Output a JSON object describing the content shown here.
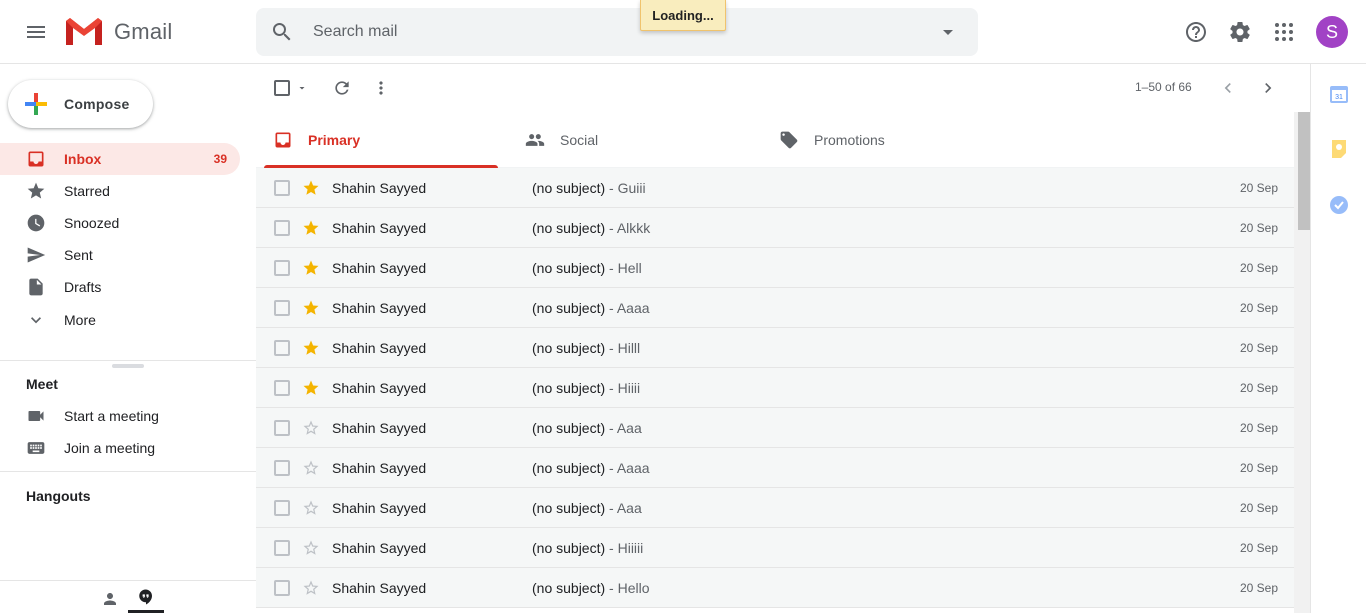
{
  "header": {
    "app_name": "Gmail",
    "search_placeholder": "Search mail",
    "loading_text": "Loading...",
    "avatar_letter": "S",
    "avatar_color": "#a142c5"
  },
  "sidebar": {
    "compose_label": "Compose",
    "nav": [
      {
        "label": "Inbox",
        "count": "39",
        "icon": "inbox-icon",
        "active": true
      },
      {
        "label": "Starred",
        "count": "",
        "icon": "star-icon"
      },
      {
        "label": "Snoozed",
        "count": "",
        "icon": "clock-icon"
      },
      {
        "label": "Sent",
        "count": "",
        "icon": "send-icon"
      },
      {
        "label": "Drafts",
        "count": "",
        "icon": "draft-icon"
      },
      {
        "label": "More",
        "count": "",
        "icon": "chevron-down-icon"
      }
    ],
    "meet_title": "Meet",
    "meet_items": [
      {
        "label": "Start a meeting",
        "icon": "video-camera-icon"
      },
      {
        "label": "Join a meeting",
        "icon": "keyboard-icon"
      }
    ],
    "hangouts_title": "Hangouts"
  },
  "toolbar": {
    "pagination": "1–50 of 66"
  },
  "tabs": [
    {
      "label": "Primary",
      "icon": "inbox-icon",
      "active": true
    },
    {
      "label": "Social",
      "icon": "people-icon"
    },
    {
      "label": "Promotions",
      "icon": "tag-icon"
    }
  ],
  "emails": [
    {
      "sender": "Shahin Sayyed",
      "subject": "(no subject)",
      "snippet": " - Guiii",
      "date": "20 Sep",
      "starred": true
    },
    {
      "sender": "Shahin Sayyed",
      "subject": "(no subject)",
      "snippet": " - Alkkk",
      "date": "20 Sep",
      "starred": true
    },
    {
      "sender": "Shahin Sayyed",
      "subject": "(no subject)",
      "snippet": " - Hell",
      "date": "20 Sep",
      "starred": true
    },
    {
      "sender": "Shahin Sayyed",
      "subject": "(no subject)",
      "snippet": " - Aaaa",
      "date": "20 Sep",
      "starred": true
    },
    {
      "sender": "Shahin Sayyed",
      "subject": "(no subject)",
      "snippet": " - Hilll",
      "date": "20 Sep",
      "starred": true
    },
    {
      "sender": "Shahin Sayyed",
      "subject": "(no subject)",
      "snippet": " - Hiiii",
      "date": "20 Sep",
      "starred": true
    },
    {
      "sender": "Shahin Sayyed",
      "subject": "(no subject)",
      "snippet": " - Aaa",
      "date": "20 Sep",
      "starred": false
    },
    {
      "sender": "Shahin Sayyed",
      "subject": "(no subject)",
      "snippet": " - Aaaa",
      "date": "20 Sep",
      "starred": false
    },
    {
      "sender": "Shahin Sayyed",
      "subject": "(no subject)",
      "snippet": " - Aaa",
      "date": "20 Sep",
      "starred": false
    },
    {
      "sender": "Shahin Sayyed",
      "subject": "(no subject)",
      "snippet": " - Hiiiii",
      "date": "20 Sep",
      "starred": false
    },
    {
      "sender": "Shahin Sayyed",
      "subject": "(no subject)",
      "snippet": " - Hello",
      "date": "20 Sep",
      "starred": false
    }
  ],
  "colors": {
    "accent_red": "#d93025",
    "star_yellow": "#f4b400",
    "active_bg": "#fce8e6"
  }
}
